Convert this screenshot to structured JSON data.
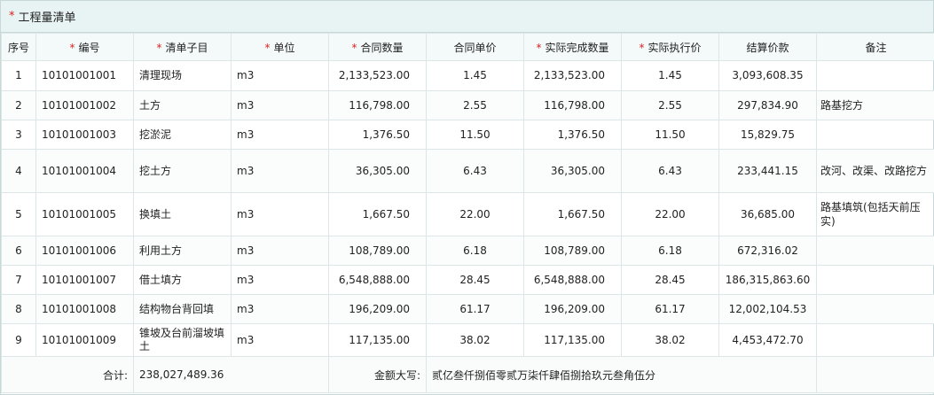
{
  "title": "工程量清单",
  "columns": [
    {
      "label": "序号",
      "required": false
    },
    {
      "label": "编号",
      "required": true
    },
    {
      "label": "清单子目",
      "required": true
    },
    {
      "label": "单位",
      "required": true
    },
    {
      "label": "合同数量",
      "required": true
    },
    {
      "label": "合同单价",
      "required": false
    },
    {
      "label": "实际完成数量",
      "required": true
    },
    {
      "label": "实际执行价",
      "required": true
    },
    {
      "label": "结算价款",
      "required": false
    },
    {
      "label": "备注",
      "required": false
    }
  ],
  "rows": [
    [
      "1",
      "10101001001",
      "清理现场",
      "m3",
      "2,133,523.00",
      "1.45",
      "2,133,523.00",
      "1.45",
      "3,093,608.35",
      ""
    ],
    [
      "2",
      "10101001002",
      "土方",
      "m3",
      "116,798.00",
      "2.55",
      "116,798.00",
      "2.55",
      "297,834.90",
      "路基挖方"
    ],
    [
      "3",
      "10101001003",
      "挖淤泥",
      "m3",
      "1,376.50",
      "11.50",
      "1,376.50",
      "11.50",
      "15,829.75",
      ""
    ],
    [
      "4",
      "10101001004",
      "挖土方",
      "m3",
      "36,305.00",
      "6.43",
      "36,305.00",
      "6.43",
      "233,441.15",
      "改河、改渠、改路挖方"
    ],
    [
      "5",
      "10101001005",
      "换填土",
      "m3",
      "1,667.50",
      "22.00",
      "1,667.50",
      "22.00",
      "36,685.00",
      "路基填筑(包括天前压实)"
    ],
    [
      "6",
      "10101001006",
      "利用土方",
      "m3",
      "108,789.00",
      "6.18",
      "108,789.00",
      "6.18",
      "672,316.02",
      ""
    ],
    [
      "7",
      "10101001007",
      "借土填方",
      "m3",
      "6,548,888.00",
      "28.45",
      "6,548,888.00",
      "28.45",
      "186,315,863.60",
      ""
    ],
    [
      "8",
      "10101001008",
      "结构物台背回填",
      "m3",
      "196,209.00",
      "61.17",
      "196,209.00",
      "61.17",
      "12,002,104.53",
      ""
    ],
    [
      "9",
      "10101001009",
      "锥坡及台前溜坡填土",
      "m3",
      "117,135.00",
      "38.02",
      "117,135.00",
      "38.02",
      "4,453,472.70",
      ""
    ]
  ],
  "footer": {
    "total_label": "合计:",
    "total_value": "238,027,489.36",
    "amount_words_label": "金额大写:",
    "amount_words_value": "贰亿叁仟捌佰零贰万柒仟肆佰捌拾玖元叁角伍分"
  }
}
